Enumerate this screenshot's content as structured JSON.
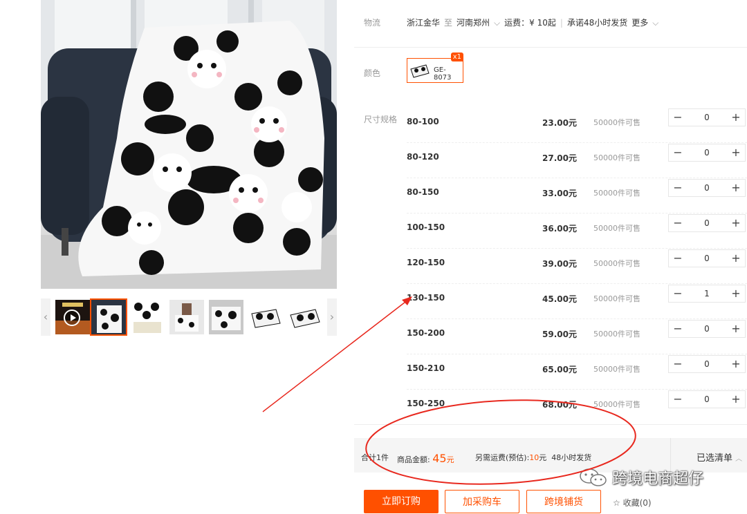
{
  "logistics": {
    "label": "物流",
    "origin": "浙江金华",
    "to": "至",
    "destination": "河南郑州",
    "fee": "运费：¥ 10起",
    "promise": "承诺48小时发货",
    "more": "更多"
  },
  "color": {
    "label": "颜色",
    "option": "GE-8073",
    "badge": "x1"
  },
  "size": {
    "label": "尺寸规格",
    "rows": [
      {
        "name": "80-100",
        "price": "23.00元",
        "stock": "50000件可售",
        "qty": "0"
      },
      {
        "name": "80-120",
        "price": "27.00元",
        "stock": "50000件可售",
        "qty": "0"
      },
      {
        "name": "80-150",
        "price": "33.00元",
        "stock": "50000件可售",
        "qty": "0"
      },
      {
        "name": "100-150",
        "price": "36.00元",
        "stock": "50000件可售",
        "qty": "0"
      },
      {
        "name": "120-150",
        "price": "39.00元",
        "stock": "50000件可售",
        "qty": "0"
      },
      {
        "name": "130-150",
        "price": "45.00元",
        "stock": "50000件可售",
        "qty": "1"
      },
      {
        "name": "150-200",
        "price": "59.00元",
        "stock": "50000件可售",
        "qty": "0"
      },
      {
        "name": "150-210",
        "price": "65.00元",
        "stock": "50000件可售",
        "qty": "0"
      },
      {
        "name": "150-250",
        "price": "68.00元",
        "stock": "50000件可售",
        "qty": "0"
      }
    ],
    "minus": "−",
    "plus": "+"
  },
  "summary": {
    "total_label": "合计1件",
    "amount_label": "商品金额:",
    "amount_value": "45",
    "amount_unit": "元",
    "shipping_label": "另需运费(预估):",
    "shipping_value": "10",
    "shipping_unit": "元",
    "shipping_time": "48小时发货",
    "cart_list": "已选清单"
  },
  "actions": {
    "buy": "立即订购",
    "add_cart": "加采购车",
    "crossborder": "跨境铺货",
    "favorite": "☆ 收藏(0)"
  },
  "gallery": {
    "prev": "‹",
    "next": "›"
  },
  "watermark": "跨境电商超仔",
  "colors": {
    "accent": "#ff5000",
    "annotation": "#e8281e"
  }
}
